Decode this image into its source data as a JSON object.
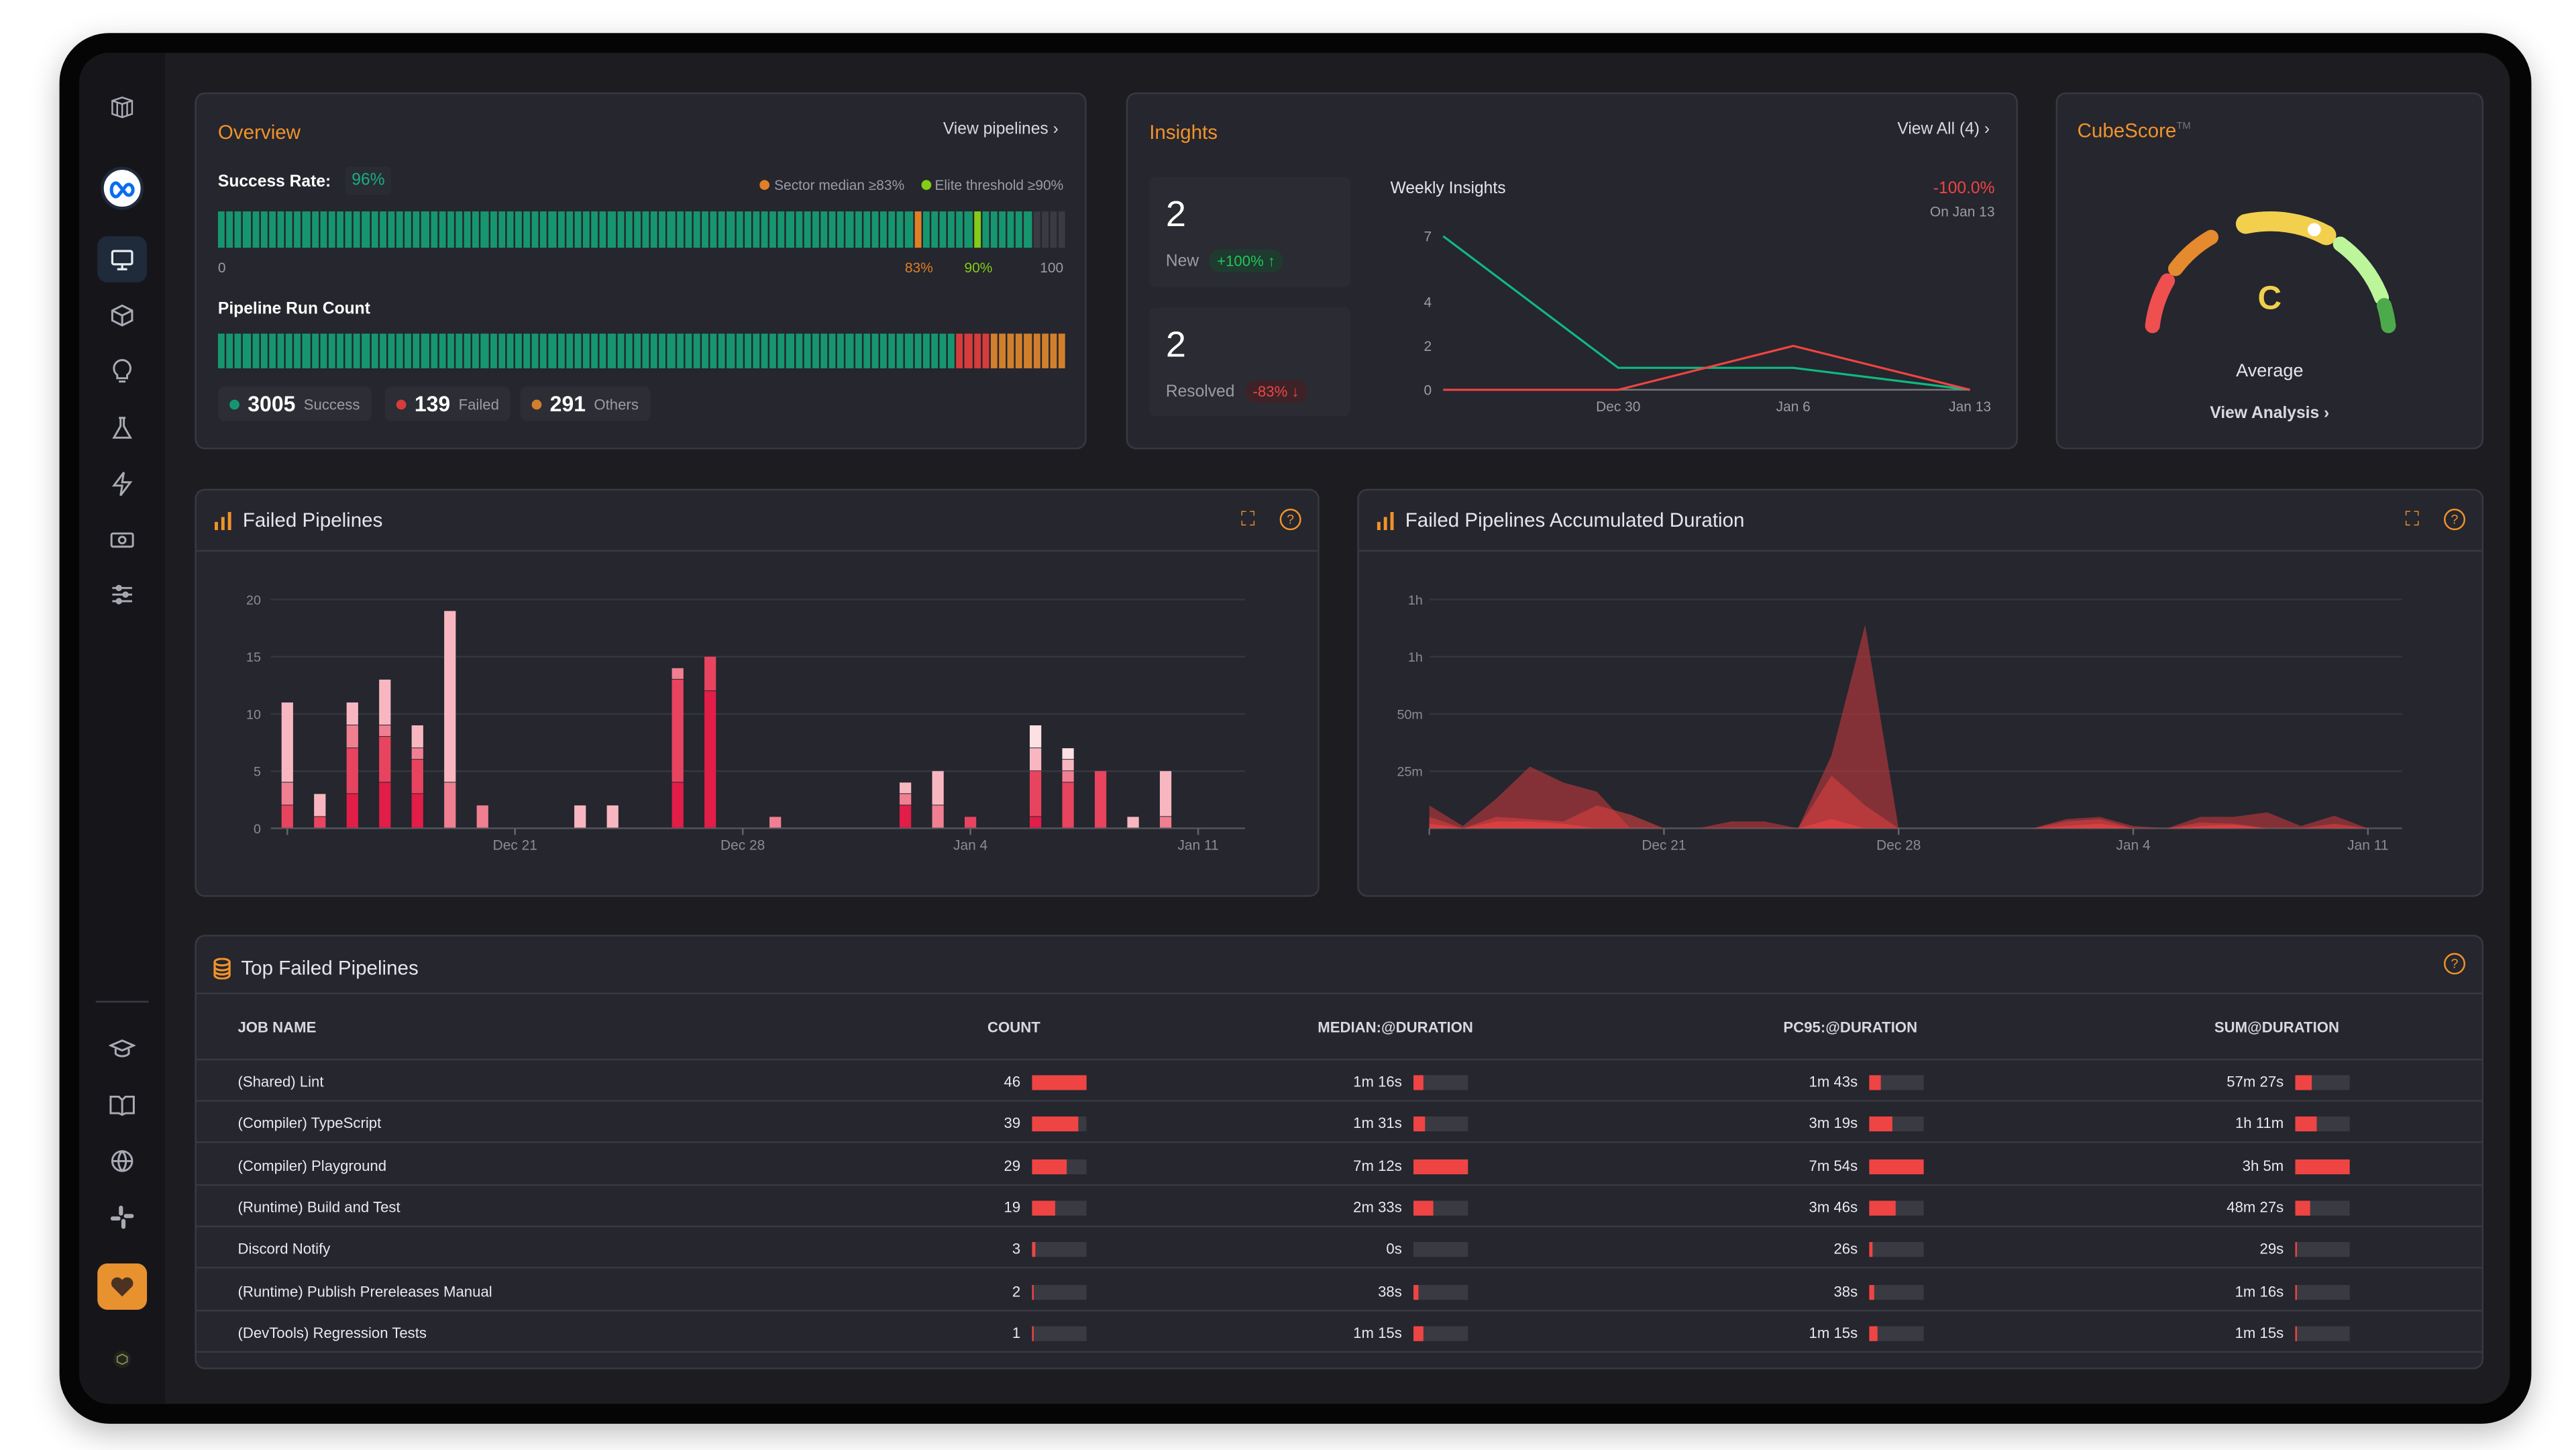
{
  "sidebar": {
    "items": [
      {
        "icon": "cube-logo-icon"
      },
      {
        "icon": "meta-logo-icon"
      },
      {
        "icon": "monitor-icon",
        "active": true
      },
      {
        "icon": "box-icon"
      },
      {
        "icon": "lightbulb-icon"
      },
      {
        "icon": "flask-icon"
      },
      {
        "icon": "lightning-icon"
      },
      {
        "icon": "money-icon"
      },
      {
        "icon": "sliders-icon"
      },
      {
        "icon": "graduation-cap-icon"
      },
      {
        "icon": "book-icon"
      },
      {
        "icon": "globe-icon"
      },
      {
        "icon": "slack-icon"
      },
      {
        "icon": "heart-icon"
      },
      {
        "icon": "cube-small-icon"
      }
    ]
  },
  "overview": {
    "title": "Overview",
    "view_link": "View pipelines",
    "success_label": "Success Rate:",
    "success_rate": "96%",
    "success_rate_value": 96,
    "legend_median": "Sector median ≥83%",
    "legend_elite": "Elite threshold ≥90%",
    "median_threshold": 83,
    "elite_threshold": 90,
    "scale_min": "0",
    "scale_median": "83%",
    "scale_elite": "90%",
    "scale_max": "100",
    "run_count_label": "Pipeline Run Count",
    "success_count": "3005",
    "success_text": "Success",
    "failed_count": "139",
    "failed_text": "Failed",
    "others_count": "291",
    "others_text": "Others",
    "colors": {
      "success": "#16966f",
      "failed": "#d63c3c",
      "others": "#d17f2c",
      "median": "#e07f26",
      "elite": "#84cc16",
      "empty": "#3a3b42"
    }
  },
  "insights": {
    "title": "Insights",
    "view_link": "View All (4)",
    "new_value": "2",
    "new_label": "New",
    "new_badge": "+100% ↑",
    "resolved_value": "2",
    "resolved_label": "Resolved",
    "resolved_badge": "-83% ↓",
    "chart_title": "Weekly Insights",
    "change": "-100.0%",
    "change_date": "On Jan 13"
  },
  "cubescore": {
    "title": "CubeScore",
    "tm": "TM",
    "grade": "C",
    "label": "Average",
    "link": "View Analysis",
    "indicator_level": 0.62,
    "segment_colors": [
      "#ef4f4f",
      "#e58a2e",
      "#f2d04e",
      "#bdf59a",
      "#4caa4a"
    ]
  },
  "failed_chart": {
    "title": "Failed Pipelines"
  },
  "duration_chart": {
    "title": "Failed Pipelines Accumulated Duration"
  },
  "chart_data": [
    {
      "type": "line",
      "title": "Weekly Insights",
      "x_tick_labels": [
        "",
        "Dec 30",
        "Jan 6",
        "Jan 13"
      ],
      "y_ticks": [
        0,
        2,
        4,
        7
      ],
      "ylim": [
        0,
        7
      ],
      "series": [
        {
          "color": "#10b981",
          "values": [
            7,
            1,
            1,
            0
          ]
        },
        {
          "color": "#ef4444",
          "values": [
            0,
            0,
            2,
            0
          ]
        }
      ]
    },
    {
      "type": "bar",
      "stacked": true,
      "title": "Failed Pipelines",
      "dates": [
        "Dec 14",
        "Dec 15",
        "Dec 16",
        "Dec 17",
        "Dec 18",
        "Dec 19",
        "Dec 20",
        "Dec 23",
        "Dec 24",
        "Dec 26",
        "Dec 27",
        "Dec 29",
        "Jan 2",
        "Jan 3",
        "Jan 4",
        "Jan 6",
        "Jan 7",
        "Jan 8",
        "Jan 9",
        "Jan 10"
      ],
      "day_index": [
        0,
        1,
        2,
        3,
        4,
        5,
        6,
        9,
        10,
        12,
        13,
        15,
        19,
        20,
        21,
        23,
        24,
        25,
        26,
        27
      ],
      "x_tick_labels": [
        "Dec 21",
        "Dec 28",
        "Jan 4",
        "Jan 11"
      ],
      "x_tick_day_index": [
        7,
        14,
        21,
        28
      ],
      "y_ticks": [
        0,
        5,
        10,
        15,
        20
      ],
      "ylim": [
        0,
        20
      ],
      "grid": true,
      "series": [
        {
          "color": "#e11d48",
          "values": [
            0,
            0,
            3,
            4,
            3,
            0,
            0,
            0,
            0,
            4,
            12,
            0,
            2,
            0,
            0,
            1,
            0,
            0,
            0,
            0
          ]
        },
        {
          "color": "#e8445f",
          "values": [
            2,
            1,
            4,
            4,
            3,
            0,
            0,
            0,
            0,
            9,
            3,
            0,
            0,
            0,
            1,
            4,
            4,
            5,
            0,
            0
          ]
        },
        {
          "color": "#f07f92",
          "values": [
            2,
            0,
            2,
            1,
            1,
            4,
            2,
            0,
            0,
            1,
            0,
            1,
            1,
            2,
            0,
            0,
            1,
            0,
            0,
            1
          ]
        },
        {
          "color": "#f8b7c0",
          "values": [
            7,
            2,
            2,
            4,
            2,
            15,
            0,
            2,
            2,
            0,
            0,
            0,
            1,
            3,
            0,
            2,
            1,
            0,
            1,
            4
          ]
        },
        {
          "color": "#fde0e4",
          "values": [
            0,
            0,
            0,
            0,
            0,
            0,
            0,
            0,
            0,
            0,
            0,
            0,
            0,
            0,
            0,
            2,
            1,
            0,
            0,
            0
          ]
        }
      ]
    },
    {
      "type": "area",
      "title": "Failed Pipelines Accumulated Duration",
      "x_start": "Dec 14",
      "x_tick_labels": [
        "Dec 21",
        "Dec 28",
        "Jan 4",
        "Jan 11"
      ],
      "x_tick_day_index": [
        7,
        14,
        21,
        28
      ],
      "y_tick_values_minutes": [
        25,
        50,
        75,
        100
      ],
      "y_tick_labels": [
        "25m",
        "50m",
        "1h",
        "1h"
      ],
      "ylim_minutes": [
        0,
        100
      ],
      "grid": true,
      "series": [
        {
          "color": "#b5373c",
          "values": [
            10,
            1,
            13,
            27,
            20,
            16,
            0,
            0,
            0,
            3,
            3,
            0,
            32,
            89,
            0,
            0,
            0,
            0,
            0,
            4,
            5,
            1,
            0,
            5,
            5,
            7,
            1,
            5.5,
            0
          ]
        },
        {
          "color": "#d9403f",
          "values": [
            5,
            0,
            5,
            4,
            3,
            10,
            6,
            0,
            0,
            0,
            0,
            0,
            23,
            10,
            0,
            0,
            0,
            0,
            0,
            3,
            4,
            0,
            0,
            2.5,
            2,
            0,
            0,
            2,
            0
          ]
        },
        {
          "color": "#ef4444",
          "values": [
            2,
            0,
            3,
            3,
            2,
            0,
            0,
            0,
            0,
            0,
            0,
            0,
            4,
            0,
            0,
            0,
            0,
            0,
            0,
            1,
            2,
            0,
            0,
            1,
            1.5,
            0,
            0,
            0,
            0
          ]
        }
      ]
    }
  ],
  "top_failed": {
    "title": "Top Failed Pipelines",
    "columns": [
      "JOB NAME",
      "COUNT",
      "MEDIAN:@DURATION",
      "PC95:@DURATION",
      "SUM@DURATION"
    ],
    "rows": [
      {
        "name": "(Shared) Lint",
        "count": "46",
        "count_level": 1.0,
        "median": "1m 16s",
        "median_level": 0.18,
        "pc95": "1m 43s",
        "pc95_level": 0.22,
        "sum": "57m 27s",
        "sum_level": 0.31
      },
      {
        "name": "(Compiler) TypeScript",
        "count": "39",
        "count_level": 0.85,
        "median": "1m 31s",
        "median_level": 0.21,
        "pc95": "3m 19s",
        "pc95_level": 0.42,
        "sum": "1h 11m",
        "sum_level": 0.38
      },
      {
        "name": "(Compiler) Playground",
        "count": "29",
        "count_level": 0.63,
        "median": "7m 12s",
        "median_level": 1.0,
        "pc95": "7m 54s",
        "pc95_level": 1.0,
        "sum": "3h 5m",
        "sum_level": 1.0
      },
      {
        "name": "(Runtime) Build and Test",
        "count": "19",
        "count_level": 0.41,
        "median": "2m 33s",
        "median_level": 0.35,
        "pc95": "3m 46s",
        "pc95_level": 0.48,
        "sum": "48m 27s",
        "sum_level": 0.26
      },
      {
        "name": "Discord Notify",
        "count": "3",
        "count_level": 0.065,
        "median": "0s",
        "median_level": 0,
        "pc95": "26s",
        "pc95_level": 0.05,
        "sum": "29s",
        "sum_level": 0.003
      },
      {
        "name": "(Runtime) Publish Prereleases Manual",
        "count": "2",
        "count_level": 0.043,
        "median": "38s",
        "median_level": 0.09,
        "pc95": "38s",
        "pc95_level": 0.08,
        "sum": "1m 16s",
        "sum_level": 0.007
      },
      {
        "name": "(DevTools) Regression Tests",
        "count": "1",
        "count_level": 0.022,
        "median": "1m 15s",
        "median_level": 0.17,
        "pc95": "1m 15s",
        "pc95_level": 0.16,
        "sum": "1m 15s",
        "sum_level": 0.007
      }
    ]
  }
}
